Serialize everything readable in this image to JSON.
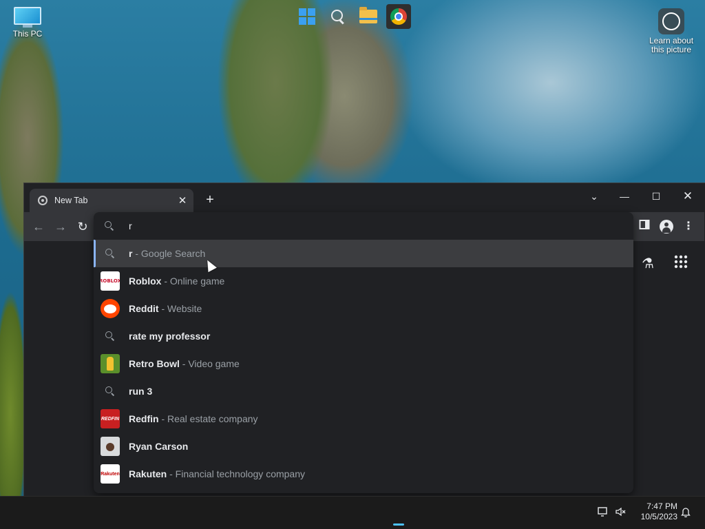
{
  "desktop": {
    "icons": [
      {
        "label": "This PC"
      },
      {
        "label": "Learn about this picture"
      }
    ]
  },
  "browser": {
    "tab": {
      "title": "New Tab",
      "close_glyph": "✕"
    },
    "new_tab_glyph": "+",
    "window_controls": {
      "tab_search": "⌄",
      "minimize": "—",
      "maximize": "☐",
      "close": "✕"
    },
    "toolbar": {
      "back": "←",
      "forward": "→",
      "reload": "↻",
      "menu": "⋮"
    },
    "ntp": {
      "labs_glyph": "⚗",
      "apps_glyph": "⋮⋮⋮"
    },
    "omnibox": {
      "input_value": "r",
      "suggestions": [
        {
          "type": "search",
          "main": "r",
          "desc": " - Google Search",
          "selected": true
        },
        {
          "type": "entity",
          "icon": "roblox-thumbnail",
          "thumb_text": "ROBLOX",
          "main": "Roblox",
          "desc": " - Online game"
        },
        {
          "type": "entity",
          "icon": "reddit-thumbnail",
          "main": "Reddit",
          "desc": " - Website"
        },
        {
          "type": "search",
          "main": "rate my professor",
          "desc": ""
        },
        {
          "type": "entity",
          "icon": "retro-bowl-thumbnail",
          "main": "Retro Bowl",
          "desc": " - Video game"
        },
        {
          "type": "search",
          "main": "run 3",
          "desc": ""
        },
        {
          "type": "entity",
          "icon": "redfin-thumbnail",
          "thumb_text": "REDFIN",
          "main": "Redfin",
          "desc": " - Real estate company"
        },
        {
          "type": "entity",
          "icon": "ryan-carson-thumbnail",
          "main": "Ryan Carson",
          "desc": ""
        },
        {
          "type": "entity",
          "icon": "rakuten-thumbnail",
          "thumb_text": "Rakuten",
          "main": "Rakuten",
          "desc": " - Financial technology company"
        }
      ]
    }
  },
  "taskbar": {
    "clock": {
      "time": "7:47 PM",
      "date": "10/5/2023"
    },
    "apps": [
      "start",
      "search",
      "file-explorer",
      "google-chrome"
    ]
  },
  "colors": {
    "accent": "#8ab4f8",
    "toolbar": "#35363a",
    "window": "#202124",
    "selected_row": "#3c3d40"
  }
}
